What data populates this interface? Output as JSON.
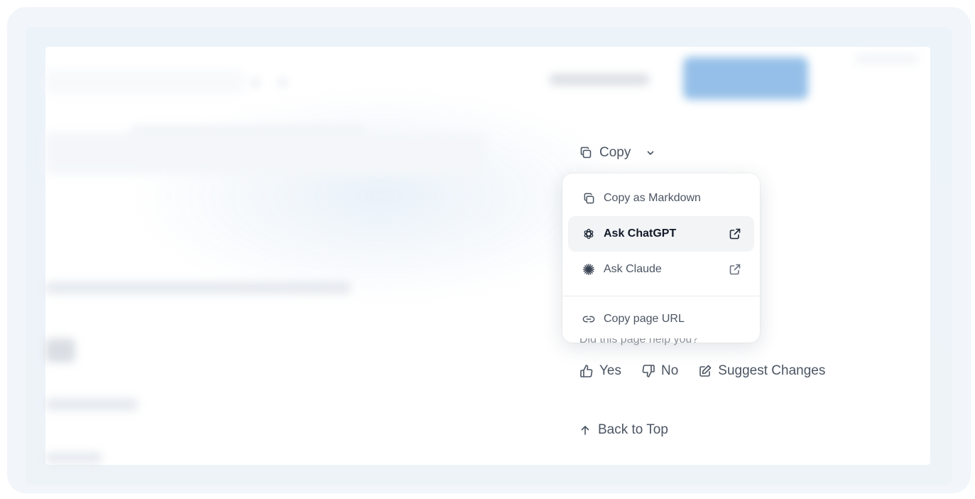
{
  "copy_button": {
    "label": "Copy"
  },
  "menu": {
    "items": [
      {
        "label": "Copy as Markdown",
        "icon": "copy-icon"
      },
      {
        "label": "Ask ChatGPT",
        "icon": "chatgpt-logo-icon",
        "external": true,
        "highlighted": true
      },
      {
        "label": "Ask Claude",
        "icon": "claude-logo-icon",
        "external": true
      },
      {
        "label": "Copy page URL",
        "icon": "link-icon"
      }
    ]
  },
  "feedback": {
    "question": "Did this page help you?",
    "yes_label": "Yes",
    "no_label": "No",
    "suggest_label": "Suggest Changes"
  },
  "back_to_top": {
    "label": "Back to Top"
  },
  "colors": {
    "text": "#4b5563",
    "text_strong": "#111827",
    "accent_blur": "#8ab9e6",
    "menu_highlight": "#f2f4f6"
  }
}
